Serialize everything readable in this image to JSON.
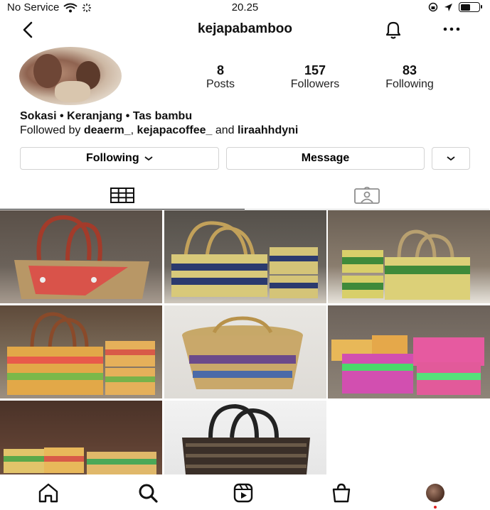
{
  "status_bar": {
    "carrier": "No Service",
    "time": "20.25"
  },
  "header": {
    "username": "kejapabamboo"
  },
  "profile": {
    "stats": [
      {
        "count": "8",
        "label": "Posts"
      },
      {
        "count": "157",
        "label": "Followers"
      },
      {
        "count": "83",
        "label": "Following"
      }
    ],
    "bio_name": "Sokasi • Keranjang • Tas bambu",
    "followed_by_prefix": "Followed by ",
    "followed_by_user1": "deaerm_",
    "followed_by_sep": ", ",
    "followed_by_user2": "kejapacoffee_",
    "followed_by_and": " and ",
    "followed_by_user3": "liraahhdyni"
  },
  "actions": {
    "following_label": "Following",
    "message_label": "Message"
  },
  "tabs": [
    {
      "icon": "grid-icon",
      "active": true
    },
    {
      "icon": "tagged-icon",
      "active": false
    }
  ],
  "posts": [
    {
      "icon": "basket-photo"
    },
    {
      "icon": "basket-photo"
    },
    {
      "icon": "basket-photo"
    },
    {
      "icon": "basket-photo"
    },
    {
      "icon": "basket-photo"
    },
    {
      "icon": "basket-photo"
    },
    {
      "icon": "basket-photo"
    },
    {
      "icon": "basket-photo"
    }
  ],
  "bottom_nav": [
    "home-icon",
    "search-icon",
    "reels-icon",
    "shop-icon",
    "profile-avatar"
  ],
  "colors": {
    "text": "#111111",
    "border": "#d3d3d3",
    "notification_dot": "#e02020"
  }
}
